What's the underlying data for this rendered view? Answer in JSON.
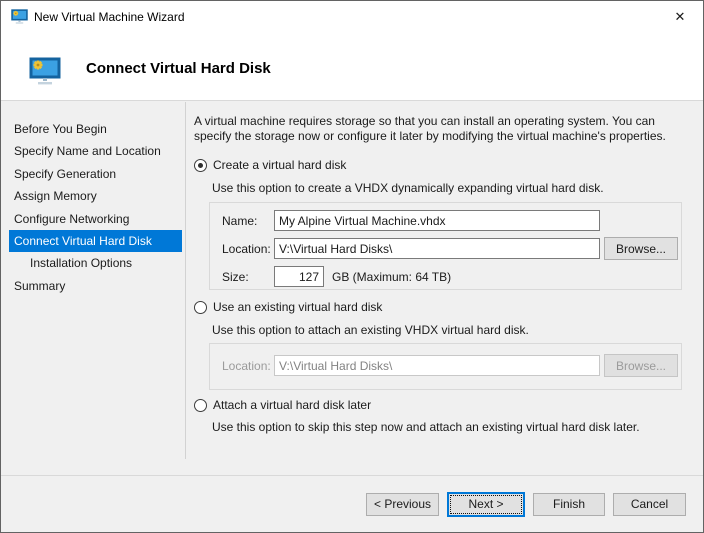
{
  "window": {
    "title": "New Virtual Machine Wizard",
    "close_glyph": "✕"
  },
  "header": {
    "title": "Connect Virtual Hard Disk"
  },
  "sidebar": {
    "items": [
      {
        "label": "Before You Begin"
      },
      {
        "label": "Specify Name and Location"
      },
      {
        "label": "Specify Generation"
      },
      {
        "label": "Assign Memory"
      },
      {
        "label": "Configure Networking"
      },
      {
        "label": "Connect Virtual Hard Disk",
        "selected": true
      },
      {
        "label": "Installation Options",
        "indented": true
      },
      {
        "label": "Summary"
      }
    ]
  },
  "content": {
    "intro": "A virtual machine requires storage so that you can install an operating system. You can specify the storage now or configure it later by modifying the virtual machine's properties.",
    "create_option": {
      "label": "Create a virtual hard disk",
      "description": "Use this option to create a VHDX dynamically expanding virtual hard disk.",
      "name_label": "Name:",
      "name_value": "My Alpine Virtual Machine.vhdx",
      "location_label": "Location:",
      "location_value": "V:\\Virtual Hard Disks\\",
      "browse_label": "Browse...",
      "size_label": "Size:",
      "size_value": "127",
      "size_suffix": "GB (Maximum: 64 TB)"
    },
    "existing_option": {
      "label": "Use an existing virtual hard disk",
      "description": "Use this option to attach an existing VHDX virtual hard disk.",
      "location_label": "Location:",
      "location_value": "V:\\Virtual Hard Disks\\",
      "browse_label": "Browse..."
    },
    "later_option": {
      "label": "Attach a virtual hard disk later",
      "description": "Use this option to skip this step now and attach an existing virtual hard disk later."
    }
  },
  "footer": {
    "previous_label": "< Previous",
    "next_label": "Next >",
    "finish_label": "Finish",
    "cancel_label": "Cancel"
  },
  "colors": {
    "accent": "#0078d7",
    "selection_text": "#ffffff",
    "body_background": "#f0f0f0",
    "header_background": "#ffffff"
  }
}
